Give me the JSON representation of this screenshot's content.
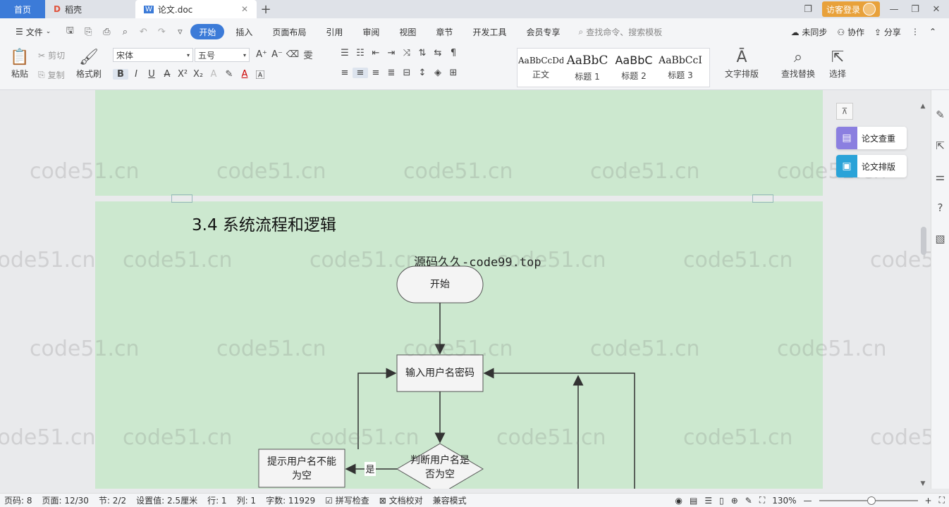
{
  "tabs": {
    "home": "首页",
    "daoke": "稻壳",
    "doc": "论文.doc",
    "login": "访客登录"
  },
  "menu": {
    "file": "文件",
    "items": [
      "开始",
      "插入",
      "页面布局",
      "引用",
      "审阅",
      "视图",
      "章节",
      "开发工具",
      "会员专享"
    ],
    "search_placeholder": "查找命令、搜索模板",
    "sync": "未同步",
    "collab": "协作",
    "share": "分享"
  },
  "ribbon": {
    "paste": "粘贴",
    "cut": "剪切",
    "copy": "复制",
    "format_painter": "格式刷",
    "font_name": "宋体",
    "font_size": "五号",
    "styles": [
      {
        "sample": "AaBbCcDd",
        "name": "正文"
      },
      {
        "sample": "AaBbC",
        "name": "标题 1"
      },
      {
        "sample": "AaBbC",
        "name": "标题 2"
      },
      {
        "sample": "AaBbCcI",
        "name": "标题 3"
      }
    ],
    "text_layout": "文字排版",
    "find_replace": "查找替换",
    "select": "选择"
  },
  "document": {
    "heading": "3.4 系统流程和逻辑",
    "site_label": "源码久久-code99.top",
    "flow": {
      "start": "开始",
      "input": "输入用户名密码",
      "decision_line1": "判断用户名是",
      "decision_line2": "否为空",
      "prompt_line1": "提示用户名不能",
      "prompt_line2": "为空",
      "yes": "是"
    }
  },
  "side_panel": {
    "check": "论文查重",
    "layout": "论文排版"
  },
  "watermark": "code51.cn",
  "status": {
    "page_code": "页码: 8",
    "page": "页面: 12/30",
    "section": "节: 2/2",
    "setting": "设置值: 2.5厘米",
    "row": "行: 1",
    "col": "列: 1",
    "words": "字数: 11929",
    "spell": "拼写检查",
    "proof": "文档校对",
    "compat": "兼容模式",
    "zoom": "130%"
  }
}
